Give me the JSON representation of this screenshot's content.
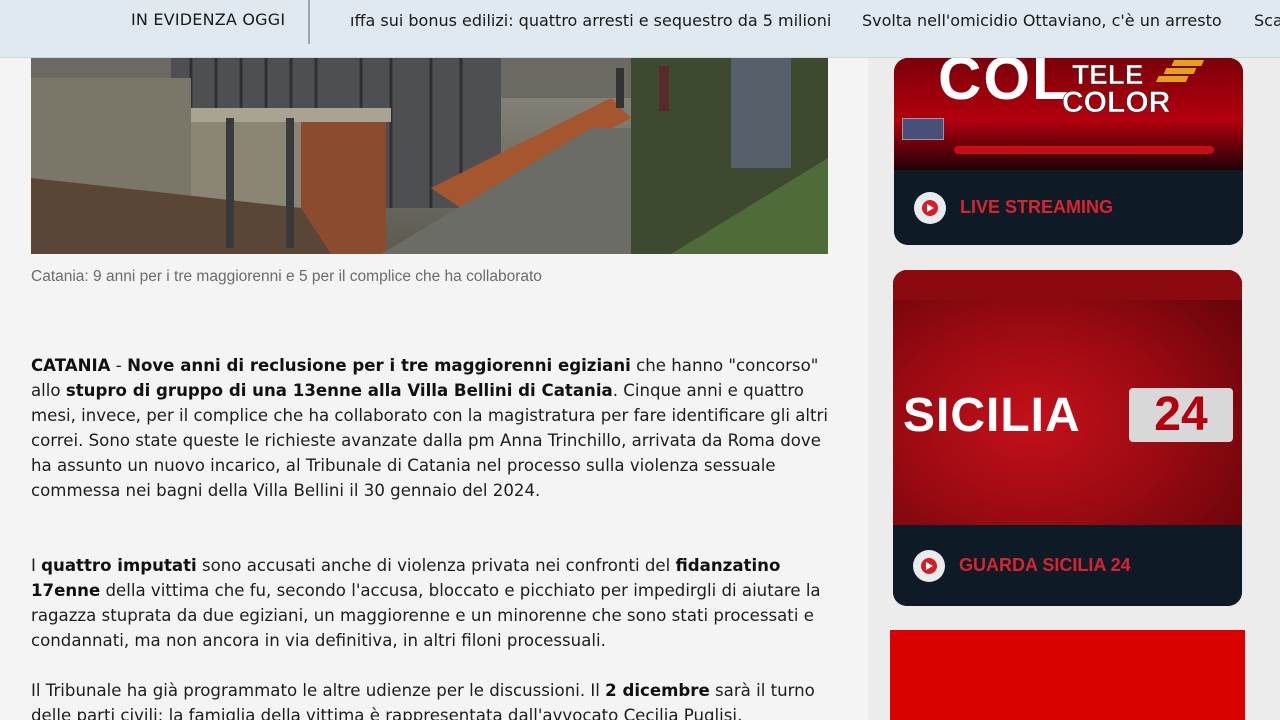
{
  "ticker": {
    "label": "IN EVIDENZA OGGI",
    "items": [
      "ıffa sui bonus edilizi: quattro arresti e sequestro da 5 milioni",
      "Svolta nell'omicidio Ottaviano, c'è un arresto",
      "Sca"
    ]
  },
  "overlay_logo": {
    "line1": "TELE",
    "line2": "COLOR"
  },
  "article": {
    "caption": "Catania: 9 anni per i tre maggiorenni e 5 per il complice che ha collaborato",
    "p1": {
      "dateline": "CATANIA",
      "dash": " - ",
      "b1": "Nove anni di reclusione per i tre maggiorenni egiziani",
      "t1": " che hanno \"concorso\" allo ",
      "b2": "stupro di gruppo di una 13enne alla Villa Bellini di Catania",
      "t2": ". Cinque anni e quattro mesi, invece, per il complice che ha collaborato con la magistratura per fare identificare gli altri correi. Sono state queste le richieste avanzate dalla pm Anna Trinchillo, arrivata da Roma dove ha assunto un nuovo incarico, al Tribunale di Catania nel processo sulla violenza sessuale commessa nei bagni della Villa Bellini il 30 gennaio del 2024."
    },
    "p2": {
      "t0": "I ",
      "b1": "quattro imputati",
      "t1": " sono accusati anche di violenza privata nei confronti del ",
      "b2": "fidanzatino 17enne",
      "t2": " della vittima che fu, secondo l'accusa, bloccato e picchiato per impedirgli di aiutare la ragazza stuprata da due egiziani, un maggiorenne e un minorenne che sono stati processati e condannati, ma non ancora in via definitiva, in altri filoni processuali."
    },
    "p3": {
      "t0": "Il Tribunale ha già programmato le altre udienze per le discussioni. Il ",
      "b1": "2 dicembre",
      "t1": " sarà il turno delle parti civili: la famiglia della vittima è rappresentata dall'avvocato Cecilia Puglisi,"
    }
  },
  "sidebar": {
    "card1": {
      "banner_text": "COL",
      "label": "LIVE STREAMING"
    },
    "card2": {
      "banner_text": "SICILIA",
      "banner_num": "24",
      "label": "GUARDA SICILIA 24"
    }
  },
  "colors": {
    "accent_red": "#d9242e",
    "card_navy": "#0e1a26",
    "ticker_bg": "#dfe9ef"
  }
}
